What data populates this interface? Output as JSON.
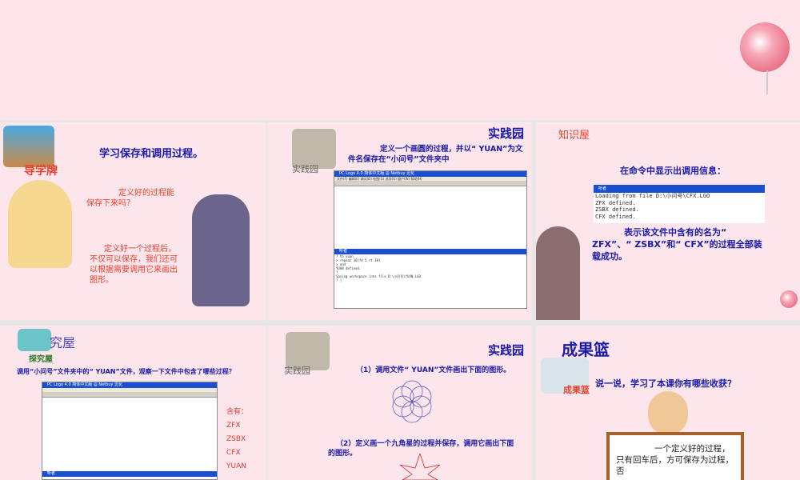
{
  "slide1": {
    "badge": "导学牌",
    "title": "学习保存和调用过程。",
    "q": "定义好的过程能保存下来吗？",
    "a": "定义好一个过程后，不仅可以保存，我们还可以根据需要调用它来画出图形。"
  },
  "slide2": {
    "badge": "实践园",
    "heading": "实践园",
    "text": "定义一个画圆的过程，并以“ YUAN”为文件名保存在“小问号”文件夹中",
    "window_title": "PC Logo 4.0 简体中文版  @ Netbuy  迅化",
    "menu": "文件(F) 编辑(E) 调试(D) 绘图(G) 选项(O) 窗户(W) 帮助(H)",
    "listener": "听者",
    "console": [
      "? to yuan",
      "> repeat 36[fd 5 rt 10]",
      "> end",
      "YUAN defined.",
      "?",
      "Saving workspace into file D:\\小问号\\YUAN.LGO",
      "? |"
    ]
  },
  "slide3": {
    "heading": "知识屋",
    "title": "在命令中显示出调用信息：",
    "listener": "听者",
    "console": [
      "Loading from file D:\\小问号\\CFX.LGO",
      "ZFX defined.",
      "ZSBX defined.",
      "CFX defined."
    ],
    "text": "表示该文件中含有的名为“ ZFX”、“ ZSBX”和“ CFX”的过程全部装载成功。"
  },
  "slide4": {
    "badge": "探究屋",
    "heading": "究屋",
    "text": "调用“小问号”文件夹中的“ YUAN”文件，观察一下文件中包含了哪些过程？",
    "window_title": "PC Logo 4.0 简体中文版  @ Netbuy  迅化",
    "listener": "听者",
    "contains_label": "含有：",
    "contains": [
      "ZFX",
      "ZSBX",
      "CFX",
      "YUAN"
    ]
  },
  "slide5": {
    "badge": "实践园",
    "heading": "实践园",
    "q1": "（1）调用文件“ YUAN”文件画出下面的图形。",
    "q2": "（2）定义画一个九角星的过程并保存，调用它画出下面的图形。"
  },
  "slide6": {
    "heading": "成果篮",
    "badge": "成果篮",
    "q": "说一说，学习了本课你有哪些收获？",
    "board": "一个定义好的过程，只有回车后，方可保存为过程，否"
  }
}
